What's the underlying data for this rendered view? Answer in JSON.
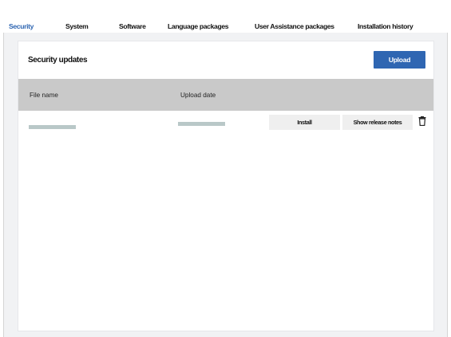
{
  "tabs": [
    {
      "label": "Security",
      "active": true
    },
    {
      "label": "System",
      "active": false
    },
    {
      "label": "Software",
      "active": false
    },
    {
      "label": "Language packages",
      "active": false
    },
    {
      "label": "User Assistance packages",
      "active": false
    },
    {
      "label": "Installation history",
      "active": false
    }
  ],
  "panel": {
    "title": "Security updates",
    "upload_label": "Upload"
  },
  "table": {
    "columns": [
      "File name",
      "Upload date"
    ],
    "row_actions": {
      "install_label": "Install",
      "release_notes_label": "Show release notes",
      "delete_icon": "trash-icon"
    }
  },
  "colors": {
    "accent": "#2f66b2",
    "header_bg": "#c9c9c9",
    "placeholder": "#b9c8c8"
  }
}
